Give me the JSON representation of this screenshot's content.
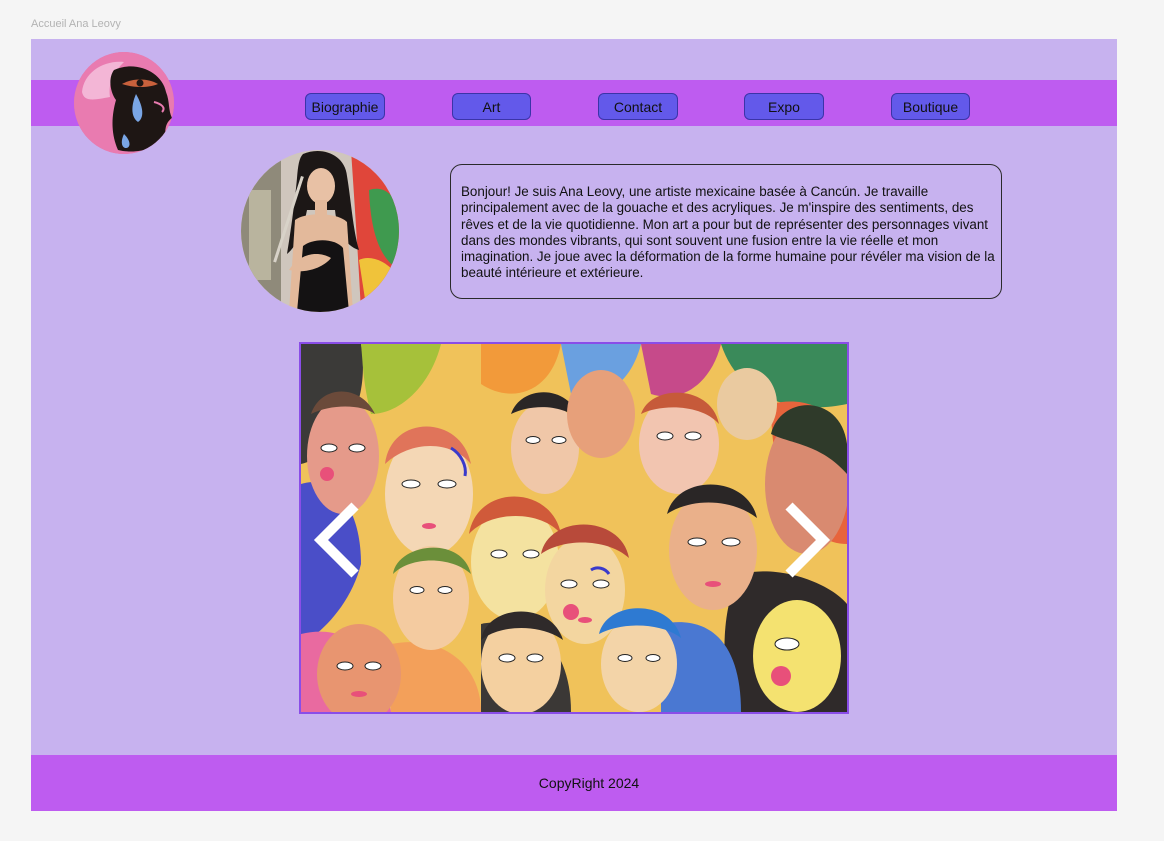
{
  "frame_label": "Accueil Ana Leovy",
  "nav": {
    "items": [
      {
        "label": "Biographie"
      },
      {
        "label": "Art"
      },
      {
        "label": "Contact"
      },
      {
        "label": "Expo"
      },
      {
        "label": "Boutique"
      }
    ]
  },
  "bio": {
    "text": "Bonjour! Je suis Ana Leovy, une artiste mexicaine basée à Cancún. Je travaille principalement avec de la gouache et des acryliques. Je m'inspire des sentiments, des rêves et de la vie quotidienne. Mon art a pour but de représenter des personnages vivant dans des mondes vibrants, qui sont souvent une fusion entre la vie réelle et mon imagination. Je joue avec la déformation de la forme humaine pour révéler ma vision de la beauté intérieure et extérieure."
  },
  "carousel": {
    "prev_icon": "chevron-left-icon",
    "next_icon": "chevron-right-icon"
  },
  "footer": {
    "text": "CopyRight 2024"
  },
  "colors": {
    "canvas_bg": "#f5f5f5",
    "page_bg": "#c7b2ef",
    "bars": "#be5cf0",
    "nav_button": "#6359ea",
    "carousel_border": "#8a4de8"
  }
}
